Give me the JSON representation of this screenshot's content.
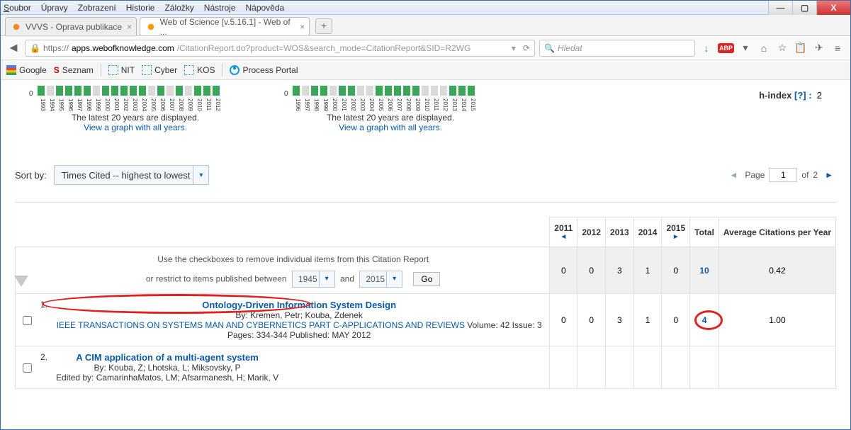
{
  "window": {
    "menus": [
      "Soubor",
      "Úpravy",
      "Zobrazení",
      "Historie",
      "Záložky",
      "Nástroje",
      "Nápověda"
    ],
    "controls": {
      "min": "—",
      "max": "▢",
      "close": "X"
    }
  },
  "tabs": [
    {
      "label": "VVVS - Oprava publikace",
      "active": false
    },
    {
      "label": "Web of Science [v.5.16.1] - Web of ...",
      "active": true
    }
  ],
  "nav": {
    "back": "◄",
    "url_lock": "🔒",
    "url_scheme": "https://",
    "url_domain": "apps.webofknowledge.com",
    "url_rest": "/CitationReport.do?product=WOS&search_mode=CitationReport&SID=R2WG",
    "dropdown": "▾",
    "reload": "⟳",
    "search_placeholder": "Hledat",
    "icons": {
      "download": "↓",
      "abp": "ABP",
      "dd": "▾",
      "home": "⌂",
      "star": "☆",
      "clip": "📋",
      "send": "✈",
      "menu": "≡"
    }
  },
  "bookmarks": [
    "Google",
    "Seznam",
    "NIT",
    "Cyber",
    "KOS",
    "Process Portal"
  ],
  "hindex": {
    "label": "h-index",
    "q": "[?] :",
    "val": "2"
  },
  "chart_caption": "The latest 20 years are displayed.",
  "chart_link": "View a graph with all years.",
  "chart_data": [
    {
      "type": "bar",
      "years": [
        "1993",
        "1994",
        "1995",
        "1996",
        "1997",
        "1998",
        "1999",
        "2000",
        "2001",
        "2002",
        "2003",
        "2004",
        "2005",
        "2006",
        "2007",
        "2008",
        "2009",
        "2010",
        "2011",
        "2012"
      ],
      "present_mask": [
        1,
        0,
        1,
        1,
        1,
        1,
        0,
        1,
        1,
        1,
        1,
        1,
        0,
        1,
        0,
        1,
        0,
        1,
        1,
        1
      ],
      "ylabel": "0"
    },
    {
      "type": "bar",
      "years": [
        "1996",
        "1997",
        "1998",
        "1999",
        "2000",
        "2001",
        "2002",
        "2003",
        "2004",
        "2005",
        "2006",
        "2007",
        "2008",
        "2009",
        "2010",
        "2011",
        "2012",
        "2013",
        "2014",
        "2015"
      ],
      "present_mask": [
        1,
        0,
        1,
        1,
        0,
        1,
        1,
        0,
        0,
        1,
        1,
        1,
        1,
        1,
        0,
        0,
        0,
        1,
        1,
        1
      ],
      "ylabel": "0"
    }
  ],
  "sort": {
    "label": "Sort by:",
    "value": "Times Cited -- highest to lowest"
  },
  "pager": {
    "page_lbl": "Page",
    "page": "1",
    "of_lbl": "of",
    "total": "2",
    "left": "◄",
    "right": "►"
  },
  "table": {
    "header_years": [
      "2011",
      "2012",
      "2013",
      "2014",
      "2015"
    ],
    "header_total": "Total",
    "header_avg": "Average Citations per Year",
    "year_left_arrow": "◄",
    "year_right_arrow": "►",
    "instruction1": "Use the checkboxes to remove individual items from this Citation Report",
    "instruction2": "or restrict to items published between",
    "year_from": "1945",
    "year_and": "and",
    "year_to": "2015",
    "go": "Go",
    "summary": {
      "c2011": "0",
      "c2012": "0",
      "c2013": "3",
      "c2014": "1",
      "c2015": "0",
      "total": "10",
      "avg": "0.42"
    },
    "rows": [
      {
        "num": "1.",
        "title": "Ontology-Driven Information System Design",
        "by": "By: Kremen, Petr; Kouba, Zdenek",
        "src": "IEEE TRANSACTIONS ON SYSTEMS MAN AND CYBERNETICS PART C-APPLICATIONS AND REVIEWS",
        "meta": "  Volume: 42   Issue: 3   Pages: 334-344   Published: MAY 2012",
        "c": [
          "0",
          "0",
          "3",
          "1",
          "0"
        ],
        "total": "4",
        "avg": "1.00",
        "annot": true
      },
      {
        "num": "2.",
        "title": "A CIM application of a multi-agent system",
        "by": "By: Kouba, Z; Lhotska, L; Miksovsky, P",
        "edited": "Edited by: CamarinhaMatos, LM; Afsarmanesh, H; Marik, V",
        "c": [
          "",
          "",
          "",
          "",
          ""
        ],
        "total": "",
        "avg": "",
        "annot": false
      }
    ]
  }
}
